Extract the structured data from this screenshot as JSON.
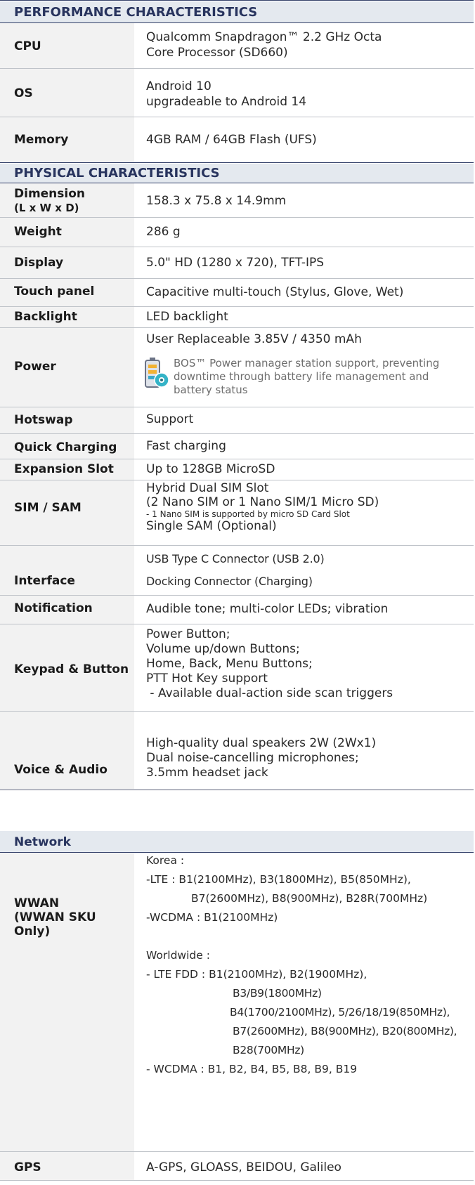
{
  "performance": {
    "title": "PERFORMANCE CHARACTERISTICS",
    "cpu": {
      "label": "CPU",
      "line1": "Qualcomm Snapdragon™ 2.2 GHz Octa",
      "line2": "Core  Processor (SD660)"
    },
    "os": {
      "label": "OS",
      "line1": "Android 10",
      "line2": "upgradeable to Android 14"
    },
    "memory": {
      "label": "Memory",
      "value": "4GB RAM / 64GB Flash (UFS)"
    }
  },
  "physical": {
    "title": "PHYSICAL CHARACTERISTICS",
    "dimension": {
      "label1": "Dimension",
      "label2": "(L x W x D)",
      "value": "158.3 x 75.8 x 14.9mm"
    },
    "weight": {
      "label": "Weight",
      "value": "286 g"
    },
    "display": {
      "label": "Display",
      "value": "5.0\" HD (1280 x 720), TFT-IPS"
    },
    "touch": {
      "label": "Touch panel",
      "value": "Capacitive multi-touch (Stylus, Glove, Wet)"
    },
    "backlight": {
      "label": "Backlight",
      "value": "LED backlight"
    },
    "power": {
      "label": "Power",
      "value": "User Replaceable 3.85V / 4350 mAh",
      "note1": "BOS™ Power manager station support, preventing",
      "note2": "downtime through battery life management and",
      "note3": "battery status",
      "icon": "battery-station-icon"
    },
    "hotswap": {
      "label": "Hotswap",
      "value": "Support"
    },
    "quick": {
      "label": "Quick Charging",
      "value": "Fast charging"
    },
    "expansion": {
      "label": "Expansion Slot",
      "value": "Up to 128GB MicroSD"
    },
    "sim": {
      "label": "SIM / SAM",
      "line1": "Hybrid Dual SIM Slot",
      "line2": "(2 Nano SIM or 1 Nano SIM/1 Micro SD)",
      "note": "- 1 Nano SIM is supported by micro SD Card Slot",
      "line3": "Single SAM (Optional)"
    },
    "interface": {
      "label": "Interface",
      "line1": "USB Type C Connector (USB 2.0)",
      "line2": "Docking Connector (Charging)"
    },
    "notification": {
      "label": "Notification",
      "value": "Audible tone; multi-color LEDs; vibration"
    },
    "keypad": {
      "label": "Keypad & Button",
      "line1": "Power Button;",
      "line2": "Volume up/down Buttons;",
      "line3": "Home, Back, Menu Buttons;",
      "line4": "PTT Hot Key support",
      "line5": " - Available dual-action side scan triggers"
    },
    "audio": {
      "label": "Voice & Audio",
      "line1": "High-quality dual speakers 2W (2Wx1)",
      "line2": "Dual noise-cancelling microphones;",
      "line3": "3.5mm headset jack"
    }
  },
  "network": {
    "title": "Network",
    "wwan": {
      "label1": "WWAN",
      "label2": "(WWAN SKU Only)",
      "lines": [
        "Korea :",
        "-LTE : B1(2100MHz),  B3(1800MHz), B5(850MHz),",
        "B7(2600MHz), B8(900MHz), B28R(700MHz)",
        "-WCDMA : B1(2100MHz)",
        "",
        "Worldwide :",
        "- LTE FDD : B1(2100MHz),  B2(1900MHz),",
        "B3/B9(1800MHz)",
        "B4(1700/2100MHz), 5/26/18/19(850MHz),",
        "B7(2600MHz), B8(900MHz), B20(800MHz),",
        "B28(700MHz)",
        "- WCDMA : B1, B2, B4, B5, B8, B9, B19"
      ]
    },
    "gps": {
      "label": "GPS",
      "value": "A-GPS, GLOASS, BEIDOU, Galileo"
    }
  },
  "colors": {
    "heading": "#28345e",
    "header_bg": "#e4e9ef",
    "label_bg": "#f2f2f2",
    "rule": "#bfc3c9"
  }
}
